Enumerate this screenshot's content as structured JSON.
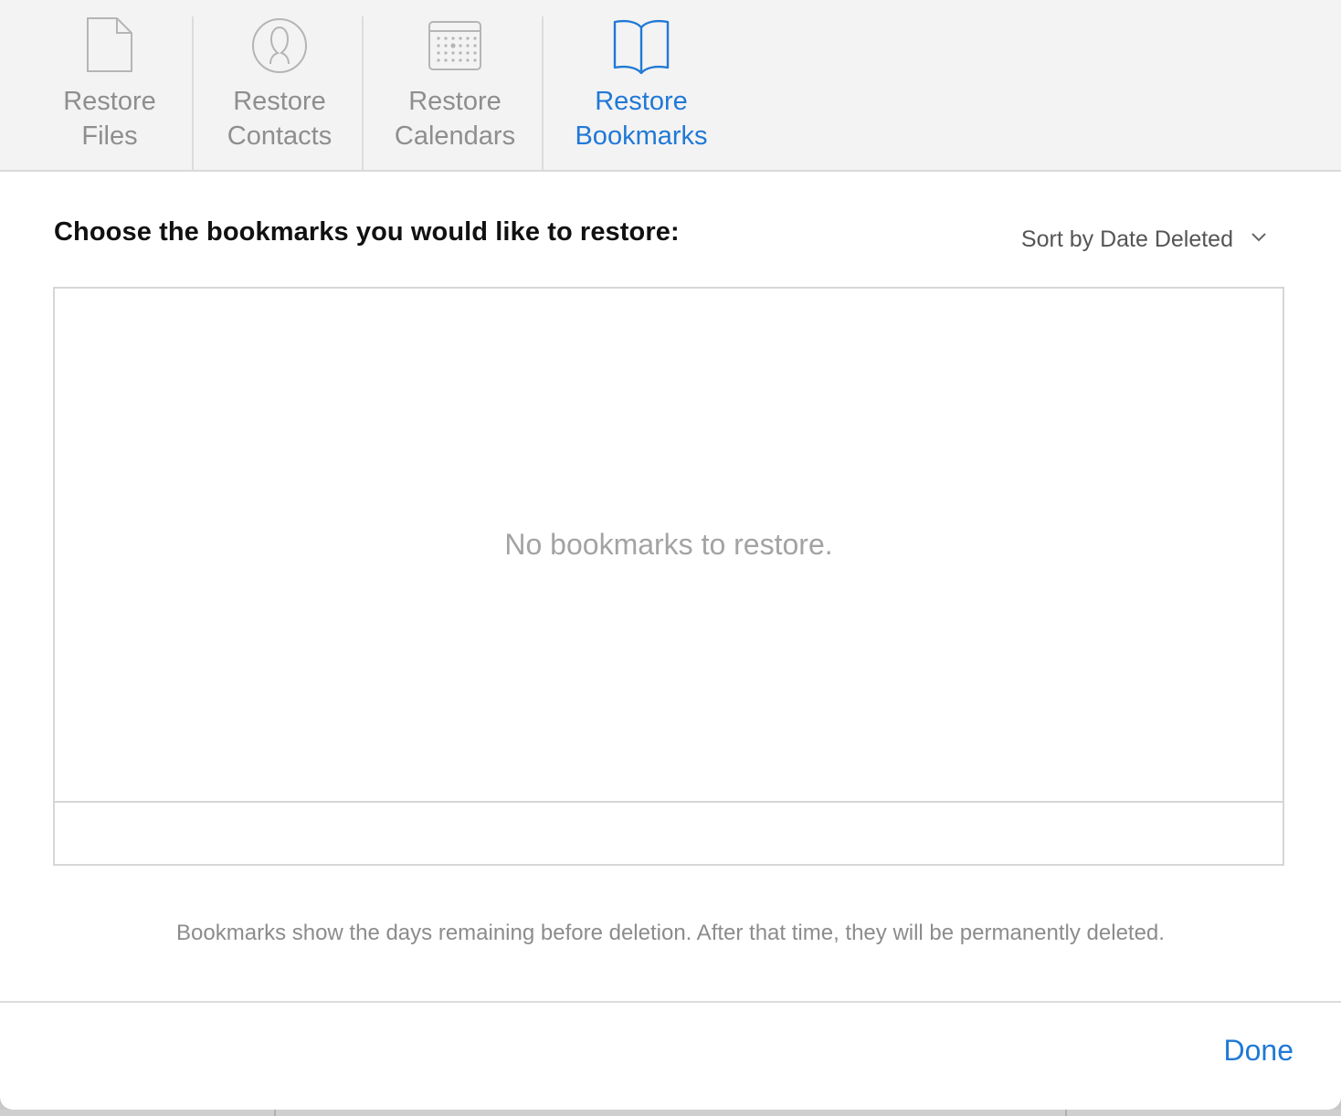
{
  "tabs": [
    {
      "label_line1": "Restore",
      "label_line2": "Files",
      "icon": "file-icon",
      "active": false
    },
    {
      "label_line1": "Restore",
      "label_line2": "Contacts",
      "icon": "contact-icon",
      "active": false
    },
    {
      "label_line1": "Restore",
      "label_line2": "Calendars",
      "icon": "calendar-icon",
      "active": false
    },
    {
      "label_line1": "Restore",
      "label_line2": "Bookmarks",
      "icon": "book-icon",
      "active": true
    }
  ],
  "main": {
    "heading": "Choose the bookmarks you would like to restore:",
    "sort_label": "Sort by Date Deleted",
    "empty_message": "No bookmarks to restore.",
    "note": "Bookmarks show the days remaining before deletion. After that time, they will be permanently deleted."
  },
  "footer": {
    "done_label": "Done"
  },
  "colors": {
    "accent": "#2079d6",
    "inactive": "#8e8e8e",
    "toolbar_bg": "#f4f3f3"
  }
}
